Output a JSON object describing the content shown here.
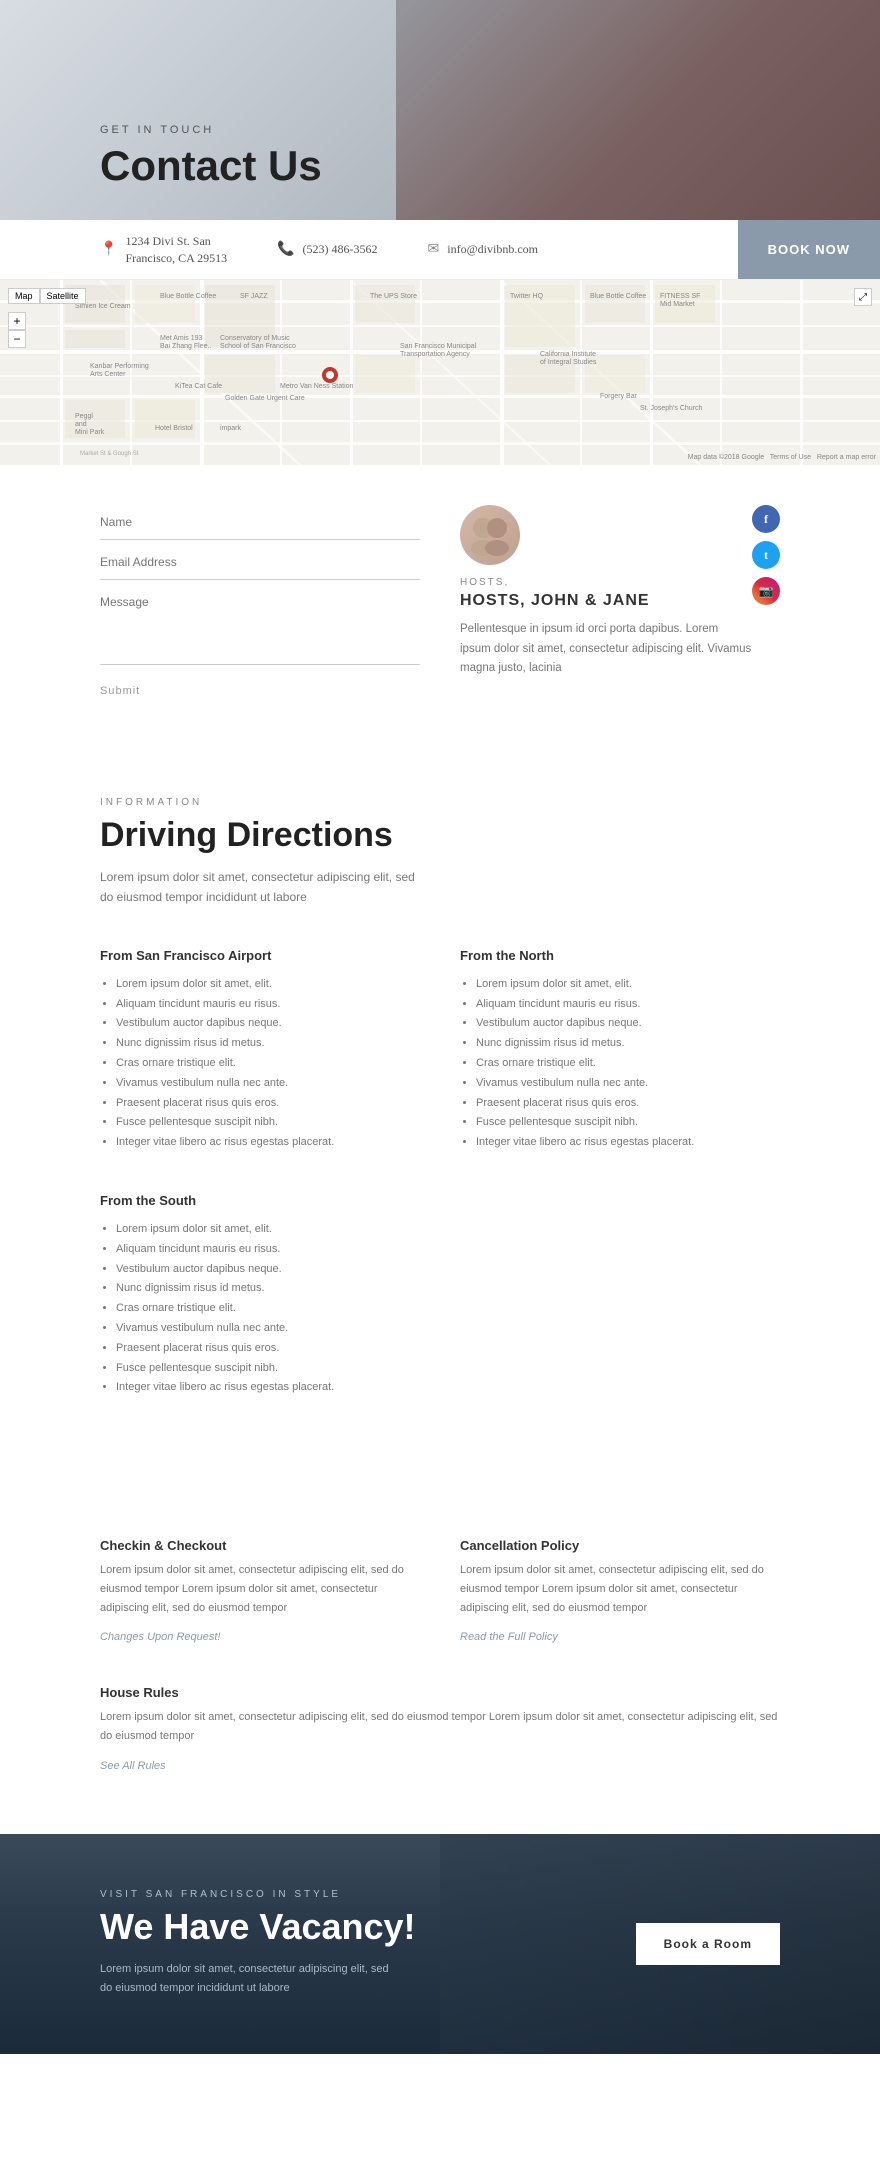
{
  "hero": {
    "eyebrow": "GET IN TOUCH",
    "title": "Contact Us"
  },
  "contact_bar": {
    "address_line1": "1234 Divi St. San",
    "address_line2": "Francisco, CA 29513",
    "phone": "(523) 486-3562",
    "email": "info@divibnb.com",
    "book_now": "Book Now"
  },
  "hosts": {
    "label": "HOSTS, JOHN & JANE",
    "description": "Pellentesque in ipsum id orci porta dapibus. Lorem ipsum dolor sit amet, consectetur adipiscing elit. Vivamus magna justo, lacinia"
  },
  "form": {
    "name_placeholder": "Name",
    "email_placeholder": "Email Address",
    "message_placeholder": "Message",
    "submit": "Submit"
  },
  "driving_directions": {
    "eyebrow": "INFORMATION",
    "title": "Driving Directions",
    "description": "Lorem ipsum dolor sit amet, consectetur adipiscing elit, sed do eiusmod tempor incididunt ut labore",
    "sections": [
      {
        "title": "From San Francisco Airport",
        "items": [
          "Lorem ipsum dolor sit amet, elit.",
          "Aliquam tincidunt mauris eu risus.",
          "Vestibulum auctor dapibus neque.",
          "Nunc dignissim risus id metus.",
          "Cras ornare tristique elit.",
          "Vivamus vestibulum nulla nec ante.",
          "Praesent placerat risus quis eros.",
          "Fusce pellentesque suscipit nibh.",
          "Integer vitae libero ac risus egestas placerat."
        ]
      },
      {
        "title": "From the North",
        "items": [
          "Lorem ipsum dolor sit amet, elit.",
          "Aliquam tincidunt mauris eu risus.",
          "Vestibulum auctor dapibus neque.",
          "Nunc dignissim risus id metus.",
          "Cras ornare tristique elit.",
          "Vivamus vestibulum nulla nec ante.",
          "Praesent placerat risus quis eros.",
          "Fusce pellentesque suscipit nibh.",
          "Integer vitae libero ac risus egestas placerat."
        ]
      },
      {
        "title": "From the South",
        "items": [
          "Lorem ipsum dolor sit amet, elit.",
          "Aliquam tincidunt mauris eu risus.",
          "Vestibulum auctor dapibus neque.",
          "Nunc dignissim risus id metus.",
          "Cras ornare tristique elit.",
          "Vivamus vestibulum nulla nec ante.",
          "Praesent placerat risus quis eros.",
          "Fusce pellentesque suscipit nibh.",
          "Integer vitae libero ac risus egestas placerat."
        ]
      }
    ]
  },
  "policies": {
    "checkin": {
      "title": "Checkin & Checkout",
      "text": "Lorem ipsum dolor sit amet, consectetur adipiscing elit, sed do eiusmod tempor Lorem ipsum dolor sit amet, consectetur adipiscing elit, sed do eiusmod tempor",
      "link": "Changes Upon Request!"
    },
    "cancellation": {
      "title": "Cancellation Policy",
      "text": "Lorem ipsum dolor sit amet, consectetur adipiscing elit, sed do eiusmod tempor Lorem ipsum dolor sit amet, consectetur adipiscing elit, sed do eiusmod tempor",
      "link": "Read the Full Policy"
    },
    "house_rules": {
      "title": "House Rules",
      "text": "Lorem ipsum dolor sit amet, consectetur adipiscing elit, sed do eiusmod tempor Lorem ipsum dolor sit amet, consectetur adipiscing elit, sed do eiusmod tempor",
      "link": "See All Rules"
    }
  },
  "cta": {
    "eyebrow": "VISIT SAN FRANCISCO IN STYLE",
    "title": "We Have Vacancy!",
    "description": "Lorem ipsum dolor sit amet, consectetur adipiscing elit, sed do eiusmod tempor incididunt ut labore",
    "button": "Book a Room"
  }
}
